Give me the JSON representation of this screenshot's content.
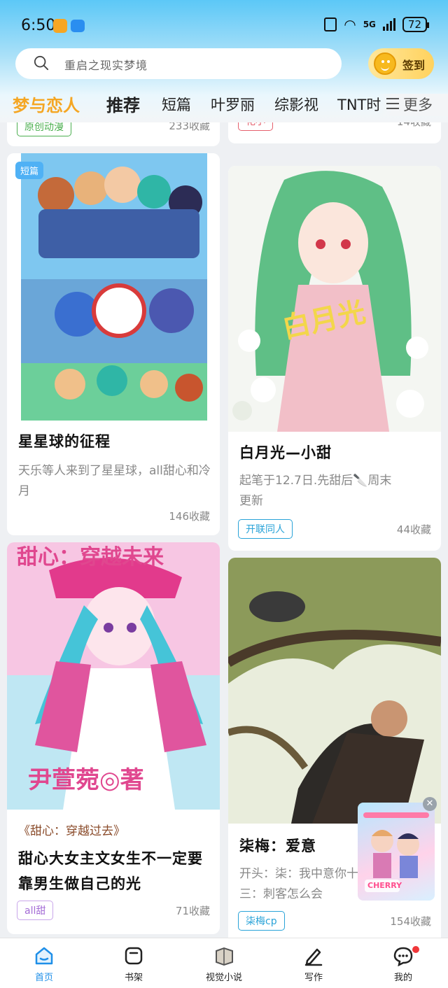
{
  "status_bar": {
    "time": "6:50",
    "network": "5G",
    "battery": "72"
  },
  "search": {
    "placeholder": "重启之现实梦境"
  },
  "signin": {
    "label": "签到"
  },
  "tabs": [
    {
      "label": "梦与恋人",
      "active": true
    },
    {
      "label": "推荐"
    },
    {
      "label": "短篇"
    },
    {
      "label": "叶罗丽"
    },
    {
      "label": "综影视"
    },
    {
      "label": "TNT时"
    }
  ],
  "more": {
    "label": "更多"
  },
  "cards_top": {
    "left": {
      "tag": "原创动漫",
      "favorites": "233收藏"
    },
    "right": {
      "tag": "花小",
      "favorites": "14收藏"
    }
  },
  "cards": [
    {
      "badge": "短篇",
      "title": "星星球的征程",
      "description": "天乐等人来到了星星球，all甜心和冷月",
      "favorites": "146收藏"
    },
    {
      "image_text": "白月光",
      "title": "白月光—小甜",
      "description": "起笔于12.7日.先甜后🔪周末更新",
      "tag": "开联同人",
      "favorites": "44收藏"
    },
    {
      "image_text_top": "甜心：穿越未来",
      "image_text_bottom": "尹萱菀◎著",
      "subtitle": "《甜心：穿越过去》",
      "title": "甜心大女主文女生不一定要靠男生做自己的光",
      "tag": "all甜",
      "favorites": "71收藏"
    },
    {
      "title": "柒梅：爱意",
      "description": "开头：柒：我中意你十三：刺客怎么会",
      "tag": "柒梅cp",
      "favorites": "154收藏"
    }
  ],
  "floating_ad": {
    "text": "CHERRY"
  },
  "nav": [
    {
      "label": "首页",
      "active": true
    },
    {
      "label": "书架"
    },
    {
      "label": "视觉小说"
    },
    {
      "label": "写作"
    },
    {
      "label": "我的"
    }
  ],
  "colors": {
    "accent": "#f5a623",
    "blue": "#1f8fe8",
    "red_dot": "#f0373a"
  }
}
